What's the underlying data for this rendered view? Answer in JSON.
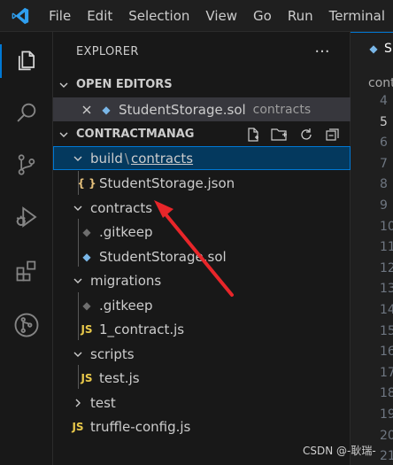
{
  "menu": [
    "File",
    "Edit",
    "Selection",
    "View",
    "Go",
    "Run",
    "Terminal"
  ],
  "activity_icons": [
    "explorer-icon",
    "search-icon",
    "source-control-icon",
    "run-debug-icon",
    "extensions-icon",
    "remote-icon"
  ],
  "explorer": {
    "title": "EXPLORER",
    "more": "···"
  },
  "open_editors": {
    "label": "OPEN EDITORS",
    "items": [
      {
        "name": "StudentStorage.sol",
        "desc": "contracts"
      }
    ]
  },
  "project": {
    "label": "CONTRACTMANAG",
    "build_label": "build",
    "build_sep": "\\",
    "build_sub": "contracts",
    "tree": [
      {
        "label": "StudentStorage.json",
        "icon": "json-icon",
        "glyph": "{ }",
        "color": "#e5c07b"
      },
      {
        "label": "contracts",
        "folder": true
      },
      {
        "label": ".gitkeep",
        "icon": "git-icon",
        "glyph": "◆",
        "color": "#6e6e6e"
      },
      {
        "label": "StudentStorage.sol",
        "icon": "solidity-icon",
        "glyph": "◆",
        "color": "#7ab7e8"
      },
      {
        "label": "migrations",
        "folder": true
      },
      {
        "label": ".gitkeep",
        "icon": "git-icon",
        "glyph": "◆",
        "color": "#6e6e6e"
      },
      {
        "label": "1_contract.js",
        "icon": "js-icon",
        "glyph": "JS",
        "color": "#e8c84a"
      },
      {
        "label": "scripts",
        "folder": true
      },
      {
        "label": "test.js",
        "icon": "js-icon",
        "glyph": "JS",
        "color": "#e8c84a"
      },
      {
        "label": "test",
        "folder": true,
        "collapsed": true
      },
      {
        "label": "truffle-config.js",
        "icon": "js-icon",
        "glyph": "JS",
        "color": "#e8c84a"
      }
    ]
  },
  "editor": {
    "tab_label": "S",
    "breadcrumb": "contr",
    "line_numbers": [
      "4",
      "5",
      "6",
      "7",
      "8",
      "9",
      "10",
      "11",
      "12",
      "13",
      "14",
      "15",
      "16",
      "17",
      "18",
      "19",
      "20",
      "21"
    ]
  },
  "watermark": "CSDN @-耿瑞-",
  "colors": {
    "accent": "#0078d4",
    "arrow": "#e8262a",
    "selection": "#04395e"
  }
}
